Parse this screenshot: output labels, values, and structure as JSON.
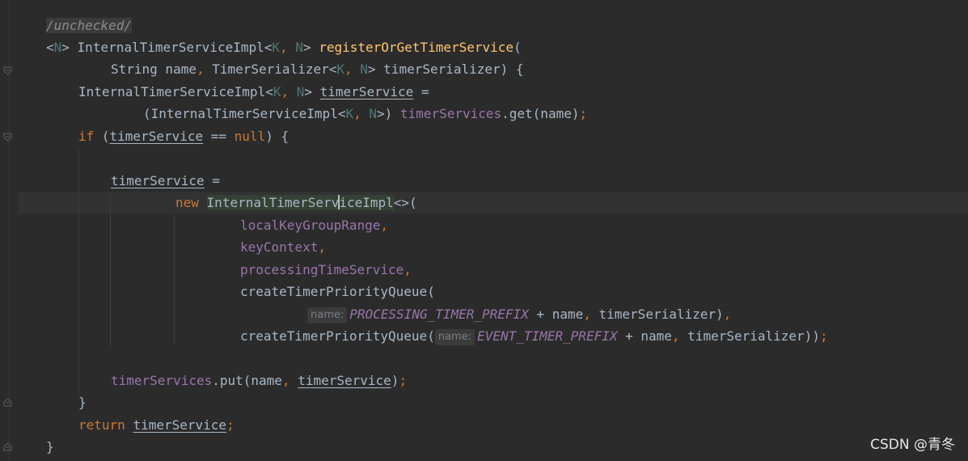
{
  "editor": {
    "annotation": "/unchecked/",
    "signature": {
      "open": "<",
      "type_param": "N",
      "close": "> ",
      "class_name": "InternalTimerServiceImpl",
      "generic_open": "<",
      "k": "K",
      "comma": ", ",
      "n": "N",
      "generic_close": ">",
      "method": "registerOrGetTimerService",
      "paren": "("
    },
    "params": {
      "string_type": "String",
      "name": " name",
      "comma": ", ",
      "ser_type": "TimerSerializer<",
      "k": "K",
      "sep": ", ",
      "n": "N",
      "rest": "> timerSerializer) {"
    },
    "decl": {
      "type": "InternalTimerServiceImpl<",
      "k": "K",
      "sep": ", ",
      "n": "N",
      "close": "> ",
      "var": "timerService",
      "eq": " ="
    },
    "cast": {
      "open": "(InternalTimerServiceImpl<",
      "k": "K",
      "sep": ", ",
      "n": "N",
      "close": ">) ",
      "field": "timerServices",
      "call": ".get(name)",
      "semi": ";"
    },
    "if_line": {
      "kw": "if",
      "open": " (",
      "var": "timerService",
      "op": " == ",
      "null_kw": "null",
      "close": ") {"
    },
    "assign": {
      "var": "timerService",
      "eq": " ="
    },
    "new_line": {
      "kw": "new",
      "class_a": "InternalTimerServ",
      "class_b": "iceImpl",
      "rest": "<>("
    },
    "args": {
      "range": "localKeyGroupRange",
      "context": "keyContext",
      "proc": "processingTimeService",
      "comma": ",",
      "create": "createTimerPriorityQueue("
    },
    "queue1": {
      "hint": "name:",
      "const": "PROCESSING_TIMER_PREFIX",
      "rest": " + name",
      "comma": ", ",
      "ser": "timerSerializer)",
      "end": ","
    },
    "queue2": {
      "create": "createTimerPriorityQueue(",
      "hint": "name:",
      "const": "EVENT_TIMER_PREFIX",
      "rest": " + name",
      "comma": ", ",
      "ser": "timerSerializer))",
      "semi": ";"
    },
    "put_line": {
      "field": "timerServices",
      "call": ".put(name",
      "comma": ", ",
      "var": "timerService",
      "close": ")",
      "semi": ";"
    },
    "close_if": "}",
    "return_line": {
      "kw": "return",
      "space": " ",
      "var": "timerService",
      "semi": ";"
    },
    "close_method": "}"
  },
  "watermark": "CSDN @青冬",
  "colors": {
    "background": "#2b2b2b",
    "keyword": "#cc7832",
    "field": "#9876aa",
    "method": "#ffc66d",
    "type_param": "#507874",
    "text": "#a9b7c6"
  }
}
